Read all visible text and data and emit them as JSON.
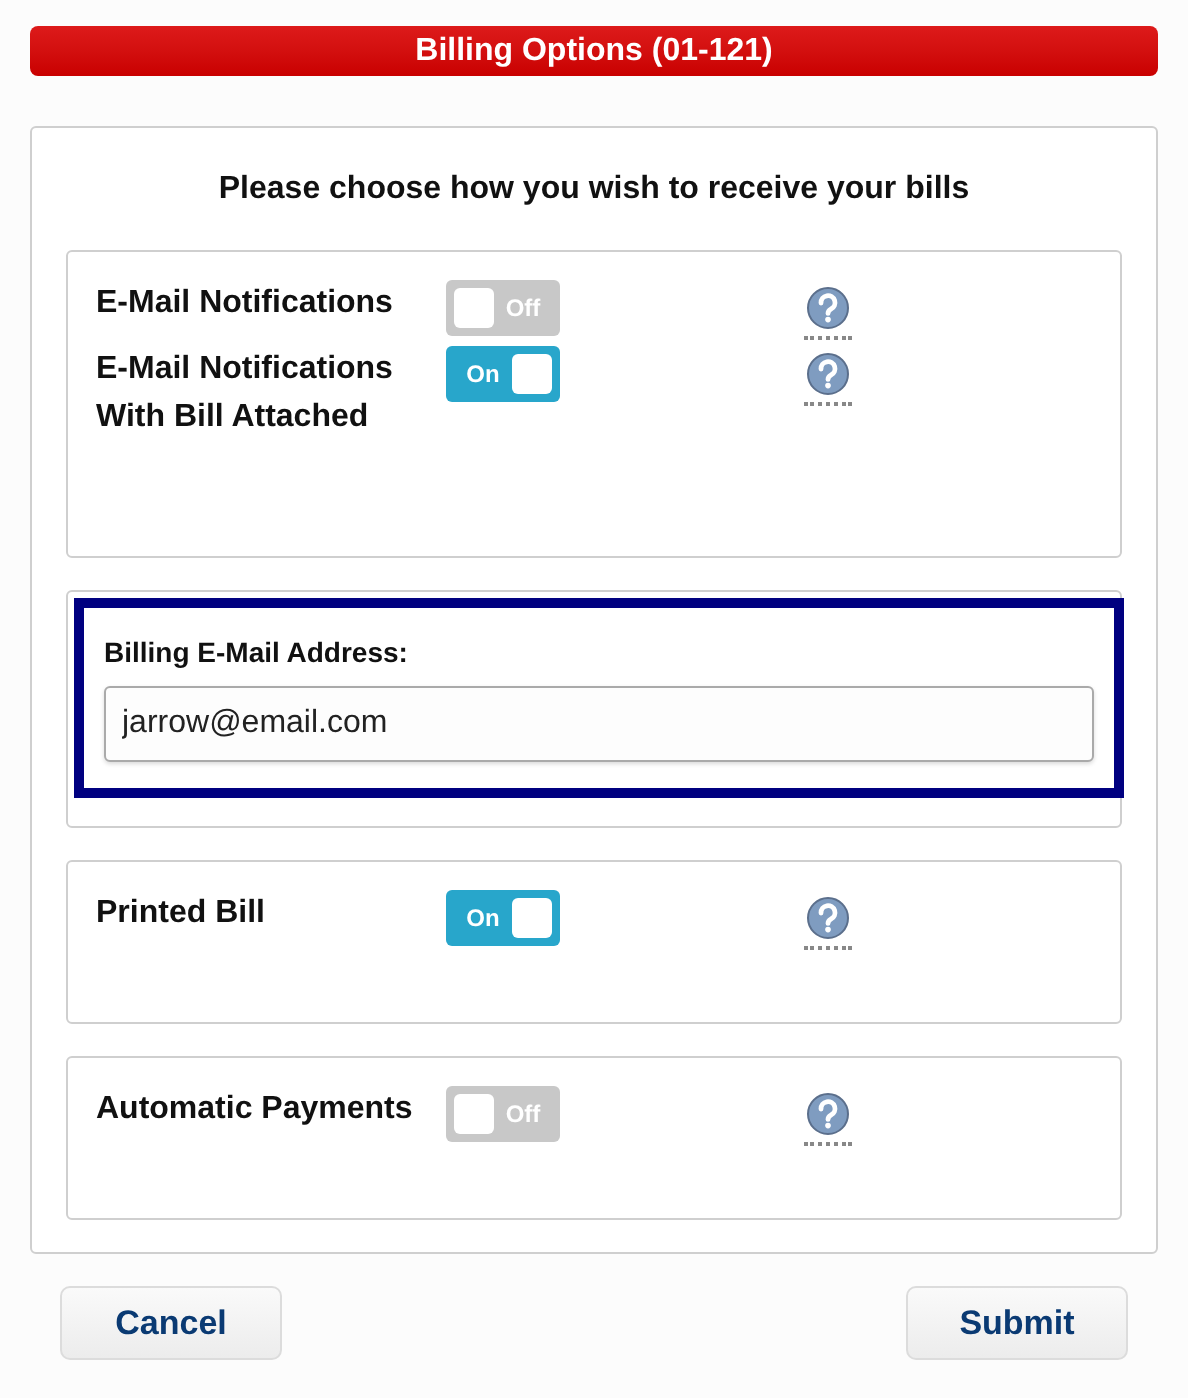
{
  "title": "Billing Options (01-121)",
  "prompt": "Please choose how you wish to receive your bills",
  "sections": [
    {
      "kind": "toggles",
      "rows": [
        {
          "label": "E-Mail Notifications",
          "on": false,
          "toggle_text": "Off"
        },
        {
          "label": "E-Mail Notifications With Bill Attached",
          "on": true,
          "toggle_text": "On"
        }
      ]
    },
    {
      "kind": "email",
      "label": "Billing E-Mail Address:",
      "value": "jarrow@email.com",
      "focused": true
    },
    {
      "kind": "toggles",
      "rows": [
        {
          "label": "Printed Bill",
          "on": true,
          "toggle_text": "On"
        }
      ]
    },
    {
      "kind": "toggles",
      "rows": [
        {
          "label": "Automatic Payments",
          "on": false,
          "toggle_text": "Off"
        }
      ]
    }
  ],
  "buttons": [
    "Cancel",
    "Submit"
  ]
}
